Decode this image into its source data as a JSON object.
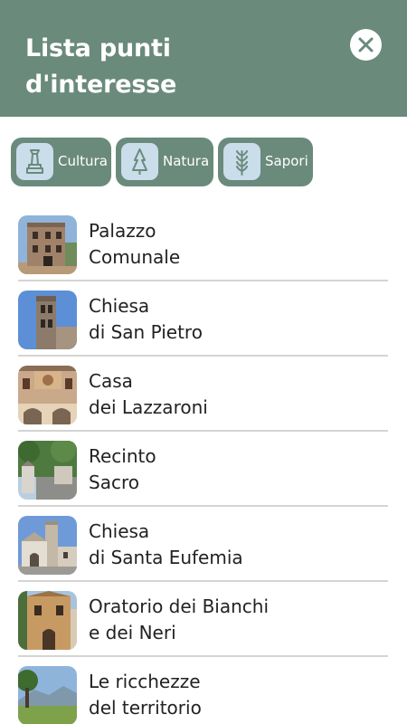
{
  "header": {
    "title_line1": "Lista punti",
    "title_line2": "d'interesse",
    "close_icon": "close-x-icon"
  },
  "filters": [
    {
      "label": "Cultura",
      "icon": "monument-icon"
    },
    {
      "label": "Natura",
      "icon": "tree-icon"
    },
    {
      "label": "Sapori",
      "icon": "wheat-icon"
    }
  ],
  "colors": {
    "primary": "#6a8a7c",
    "icon_tile": "#c9ddea",
    "divider": "#d4d4d4"
  },
  "poi": [
    {
      "line1": "Palazzo",
      "line2": "Comunale"
    },
    {
      "line1": "Chiesa",
      "line2": "di San Pietro"
    },
    {
      "line1": "Casa",
      "line2": "dei Lazzaroni"
    },
    {
      "line1": "Recinto",
      "line2": "Sacro"
    },
    {
      "line1": "Chiesa",
      "line2": "di Santa Eufemia"
    },
    {
      "line1": "Oratorio dei Bianchi",
      "line2": "e dei Neri"
    },
    {
      "line1": "Le ricchezze",
      "line2": "del territorio"
    }
  ]
}
